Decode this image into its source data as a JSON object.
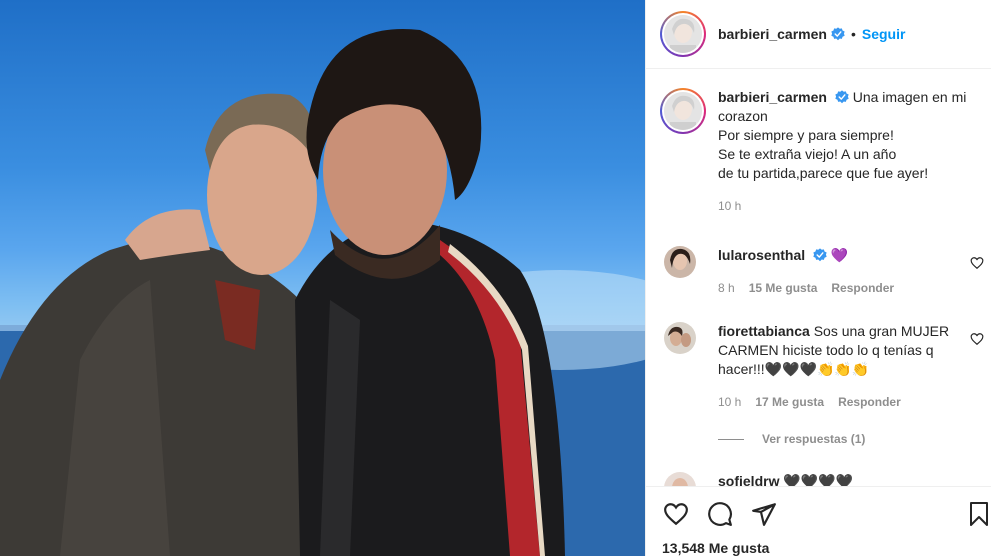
{
  "header": {
    "username": "barbieri_carmen",
    "separator": "•",
    "follow_label": "Seguir"
  },
  "caption": {
    "username": "barbieri_carmen",
    "lines": [
      "Una imagen en mi corazon",
      "Por siempre y para siempre!",
      "Se te extraña viejo! A un año",
      "de tu partida,parece que fue ayer!"
    ],
    "time": "10 h"
  },
  "comments": [
    {
      "username": "lularosenthal",
      "text": "💜",
      "time": "8 h",
      "likes": "15 Me gusta",
      "reply_label": "Responder"
    },
    {
      "username": "fiorettabianca",
      "text": "Sos una gran MUJER CARMEN hiciste todo lo q tenías q hacer!!!🖤🖤🖤👏👏👏",
      "time": "10 h",
      "likes": "17 Me gusta",
      "reply_label": "Responder"
    },
    {
      "username": "sofieldrw",
      "text": "🖤🖤🖤🖤"
    }
  ],
  "view_replies": "Ver respuestas (1)",
  "likes_count": "13,548 Me gusta",
  "icons": {
    "like": "heart-icon",
    "comment": "comment-icon",
    "share": "paper-plane-icon",
    "save": "bookmark-icon",
    "verified": "verified-badge-icon"
  },
  "colors": {
    "accent": "#0095f6",
    "verified": "#3897f0",
    "muted": "#8e8e8e",
    "heart_emoji": "#8a63d2"
  }
}
